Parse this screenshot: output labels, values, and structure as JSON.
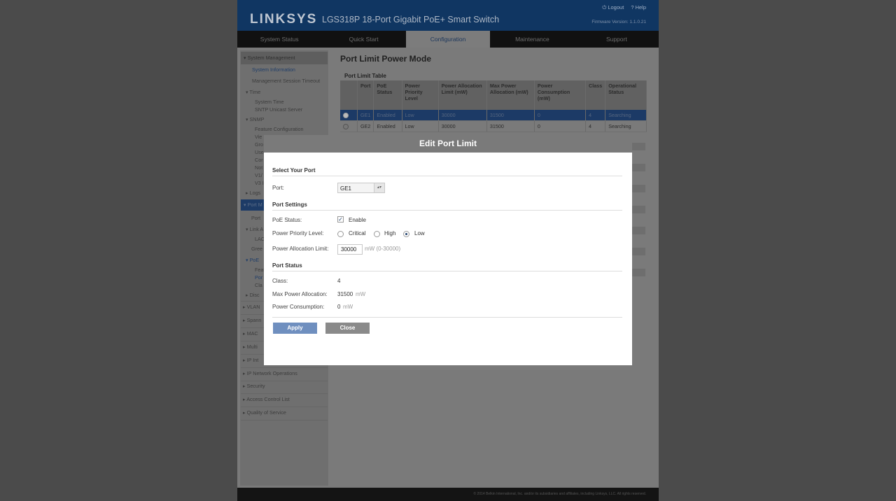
{
  "header": {
    "brand": "LINKSYS",
    "product": "LGS318P 18-Port Gigabit PoE+ Smart Switch",
    "logout": "Logout",
    "help": "Help",
    "firmware": "Firmware Version: 1.1.0.21"
  },
  "nav": [
    "System Status",
    "Quick Start",
    "Configuration",
    "Maintenance",
    "Support"
  ],
  "sidebar": {
    "system_management": "System Management",
    "system_information": "System Information",
    "mgmt_session_timeout": "Management Session Timeout",
    "time": "Time",
    "system_time": "System Time",
    "sntp": "SNTP Unicast Server",
    "snmp": "SNMP",
    "feature_config": "Feature Configuration",
    "vie": "Vie",
    "gro": "Gro",
    "use": "Use",
    "cor": "Cor",
    "not": "Not",
    "v1": "V1/",
    "v3": "V3 I",
    "logs": "Logs",
    "port_mgmt": "Port M",
    "port": "Port",
    "link_agg": "Link A",
    "lac": "LAC",
    "green": "Gree",
    "poe": "PoE",
    "poe_feat": "Feat",
    "poe_port": "Por",
    "poe_class": "Cla",
    "disc": "Disc",
    "vlan": "VLAN",
    "spanning": "Spann",
    "mac": "MAC",
    "multicast": "Multi",
    "ip_int": "IP Int",
    "ip_net": "IP Network Operations",
    "security": "Security",
    "acl": "Access Control List",
    "qos": "Quality of Service"
  },
  "page": {
    "title": "Port Limit Power Mode",
    "table_title": "Port Limit Table",
    "columns": [
      "",
      "Port",
      "PoE Status",
      "Power Priority Level",
      "Power Allocation Limit (mW)",
      "Max Power Allocation (mW)",
      "Power Consumption (mW)",
      "Class",
      "Operational Status"
    ],
    "rows": [
      {
        "port": "GE1",
        "status": "Enabled",
        "priority": "Low",
        "limit": "30000",
        "max": "31500",
        "consumption": "0",
        "class": "4",
        "op": "Searching"
      },
      {
        "port": "GE2",
        "status": "Enabled",
        "priority": "Low",
        "limit": "30000",
        "max": "31500",
        "consumption": "0",
        "class": "4",
        "op": "Searching"
      }
    ]
  },
  "dialog": {
    "title": "Edit Port Limit",
    "select_port_heading": "Select Your Port",
    "port_label": "Port:",
    "port_value": "GE1",
    "port_settings_heading": "Port Settings",
    "poe_status_label": "PoE Status:",
    "enable_label": "Enable",
    "priority_label": "Power Priority Level:",
    "critical": "Critical",
    "high": "High",
    "low": "Low",
    "alloc_label": "Power Allocation Limit:",
    "alloc_value": "30000",
    "alloc_unit": "mW (0-30000)",
    "port_status_heading": "Port Status",
    "class_label": "Class:",
    "class_value": "4",
    "max_label": "Max Power Allocation:",
    "max_value": "31500",
    "max_unit": "mW",
    "cons_label": "Power Consumption:",
    "cons_value": "0",
    "cons_unit": "mW",
    "apply": "Apply",
    "close": "Close"
  },
  "footer": "© 2014 Belkin International, Inc. and/or its subsidiaries and affiliates, including Linksys, LLC. All rights reserved.",
  "colors": {
    "brand_blue": "#103662",
    "apply_button": "#6f8fbf",
    "close_button": "#8a8a8a"
  }
}
